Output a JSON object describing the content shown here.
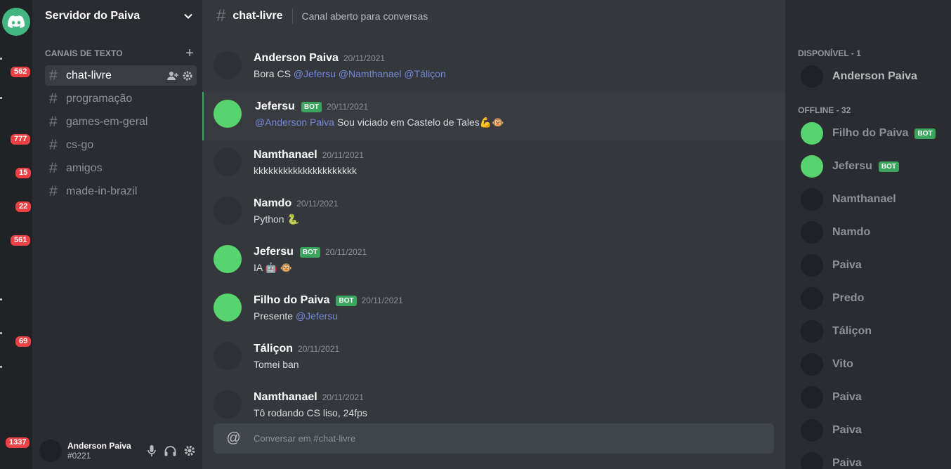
{
  "server": {
    "name": "Servidor do Paiva"
  },
  "rail": {
    "badges": [
      "562",
      "777",
      "15",
      "22",
      "561",
      "69",
      "1337"
    ]
  },
  "channels": {
    "category": "CANAIS DE TEXTO",
    "items": [
      {
        "name": "chat-livre"
      },
      {
        "name": "programação"
      },
      {
        "name": "games-em-geral"
      },
      {
        "name": "cs-go"
      },
      {
        "name": "amigos"
      },
      {
        "name": "made-in-brazil"
      }
    ]
  },
  "user": {
    "name": "Anderson Paiva",
    "tag": "#0221"
  },
  "chat": {
    "channel": "chat-livre",
    "topic": "Canal aberto para conversas",
    "input_placeholder": "Conversar em #chat-livre",
    "bot_label": "BOT",
    "messages": [
      {
        "author": "Anderson Paiva",
        "time": "20/11/2021",
        "pre": "Bora CS ",
        "mention": "@Jefersu @Namthanael @Táliçon",
        "post": ""
      },
      {
        "author": "Jefersu",
        "time": "20/11/2021",
        "pre": "",
        "mention": "@Anderson Paiva",
        "post": " Sou viciado em Castelo de Tales💪🐵"
      },
      {
        "author": "Namthanael",
        "time": "20/11/2021",
        "pre": "kkkkkkkkkkkkkkkkkkkkk",
        "mention": "",
        "post": ""
      },
      {
        "author": "Namdo",
        "time": "20/11/2021",
        "pre": "Python 🐍",
        "mention": "",
        "post": ""
      },
      {
        "author": "Jefersu",
        "time": "20/11/2021",
        "pre": "IA 🤖 🐵",
        "mention": "",
        "post": ""
      },
      {
        "author": "Filho do Paiva",
        "time": "20/11/2021",
        "pre": "Presente ",
        "mention": "@Jefersu",
        "post": ""
      },
      {
        "author": "Táliçon",
        "time": "20/11/2021",
        "pre": "Tomei ban",
        "mention": "",
        "post": ""
      },
      {
        "author": "Namthanael",
        "time": "20/11/2021",
        "pre": "Tô rodando CS liso, 24fps",
        "mention": "",
        "post": ""
      }
    ]
  },
  "members": {
    "online_label": "DISPONÍVEL - 1",
    "offline_label": "OFFLINE - 32",
    "online": [
      {
        "name": "Anderson Paiva"
      }
    ],
    "offline": [
      {
        "name": "Filho do Paiva"
      },
      {
        "name": "Jefersu"
      },
      {
        "name": "Namthanael"
      },
      {
        "name": "Namdo"
      },
      {
        "name": "Paiva"
      },
      {
        "name": "Predo"
      },
      {
        "name": "Táliçon"
      },
      {
        "name": "Vito"
      },
      {
        "name": "Paiva"
      },
      {
        "name": "Paiva"
      },
      {
        "name": "Paiva"
      }
    ]
  },
  "colors": {
    "accent_green": "#57d46d",
    "mention": "#7289da",
    "badge": "#ed4245",
    "bot_tag": "#3ba55d"
  }
}
